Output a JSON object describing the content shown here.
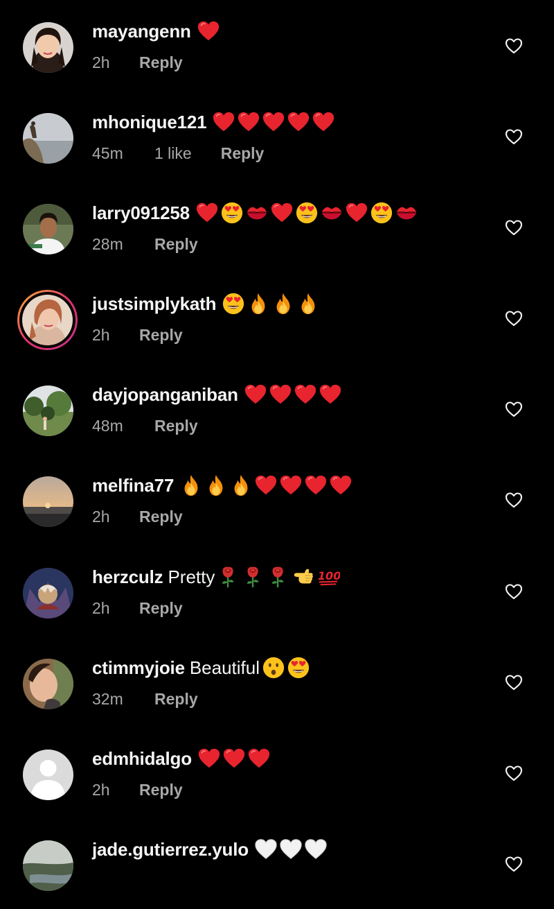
{
  "comments": [
    {
      "username": "mayangenn",
      "text": "",
      "emojis": [
        "red-heart"
      ],
      "time": "2h",
      "likes": "",
      "reply_label": "Reply",
      "avatar": "photo-woman-portrait"
    },
    {
      "username": "mhonique121",
      "text": "",
      "emojis": [
        "red-heart",
        "red-heart",
        "red-heart",
        "red-heart",
        "red-heart"
      ],
      "time": "45m",
      "likes": "1 like",
      "reply_label": "Reply",
      "avatar": "photo-landscape-cliff"
    },
    {
      "username": "larry091258",
      "text": "",
      "emojis": [
        "red-heart",
        "heart-eyes",
        "kiss-mark",
        "red-heart",
        "heart-eyes",
        "kiss-mark",
        "red-heart",
        "heart-eyes",
        "kiss-mark"
      ],
      "time": "28m",
      "likes": "",
      "reply_label": "Reply",
      "avatar": "photo-man-portrait"
    },
    {
      "username": "justsimplykath",
      "text": "",
      "emojis": [
        "heart-eyes",
        "fire",
        "fire",
        "fire"
      ],
      "time": "2h",
      "likes": "",
      "reply_label": "Reply",
      "avatar": "photo-woman-selfie-story-ring"
    },
    {
      "username": "dayjopanganiban",
      "text": "",
      "emojis": [
        "red-heart",
        "red-heart",
        "red-heart",
        "red-heart"
      ],
      "time": "48m",
      "likes": "",
      "reply_label": "Reply",
      "avatar": "photo-garden"
    },
    {
      "username": "melfina77",
      "text": "",
      "emojis": [
        "fire",
        "fire",
        "fire",
        "red-heart",
        "red-heart",
        "red-heart",
        "red-heart"
      ],
      "time": "2h",
      "likes": "",
      "reply_label": "Reply",
      "avatar": "photo-sunset-sea"
    },
    {
      "username": "herzculz",
      "text": "Pretty",
      "emojis": [
        "rose",
        "rose",
        "rose",
        "backhand-index-left",
        "hundred-points"
      ],
      "time": "2h",
      "likes": "",
      "reply_label": "Reply",
      "avatar": "photo-fantasy-art"
    },
    {
      "username": "ctimmyjoie",
      "text": "Beautiful",
      "emojis": [
        "hushed-face",
        "heart-eyes"
      ],
      "time": "32m",
      "likes": "",
      "reply_label": "Reply",
      "avatar": "photo-person-closeup"
    },
    {
      "username": "edmhidalgo",
      "text": "",
      "emojis": [
        "red-heart",
        "red-heart",
        "red-heart"
      ],
      "time": "2h",
      "likes": "",
      "reply_label": "Reply",
      "avatar": "default-profile"
    },
    {
      "username": "jade.gutierrez.yulo",
      "text": "",
      "emojis": [
        "white-heart",
        "white-heart",
        "white-heart"
      ],
      "time": "",
      "likes": "",
      "reply_label": "",
      "avatar": "photo-river-landscape"
    }
  ],
  "colors": {
    "background": "#000000",
    "primary_text": "#f5f5f5",
    "secondary_text": "#a8a8a8",
    "heart_red": "#e8242f",
    "story_ring_gradient": [
      "#f7b733",
      "#e1306c",
      "#c13584"
    ]
  },
  "like_icon": "heart-outline-icon"
}
